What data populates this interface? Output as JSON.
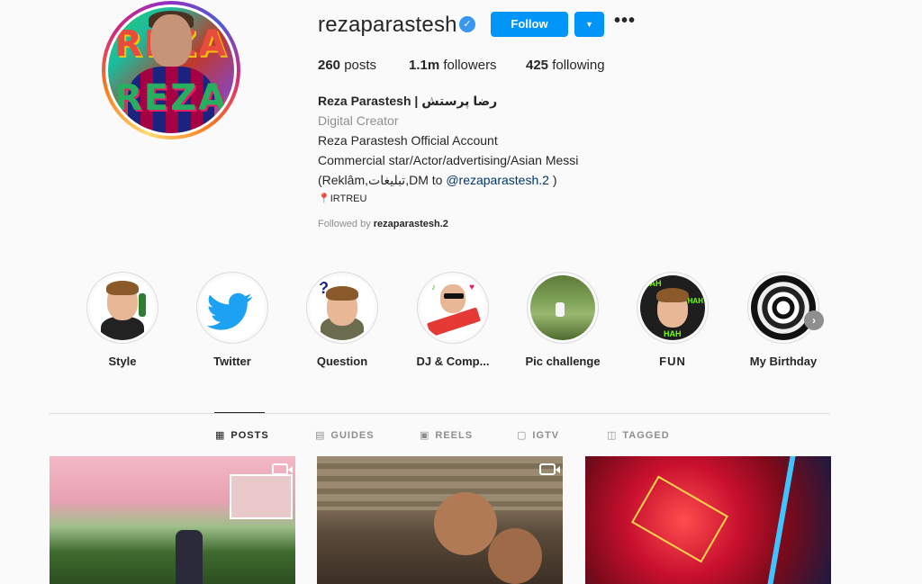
{
  "profile": {
    "username": "rezaparastesh",
    "follow_label": "Follow",
    "more_label": "•••",
    "dropdown_label": "▼",
    "verified_label": "✓"
  },
  "stats": {
    "posts_count": "260",
    "posts_label": " posts",
    "followers_count": "1.1m",
    "followers_label": " followers",
    "following_count": "425",
    "following_label": " following"
  },
  "bio": {
    "name": "Reza Parastesh | رضا پرستش",
    "category": "Digital Creator",
    "line1": "Reza Parastesh Official Account",
    "line2": "Commercial star/Actor/advertising/Asian Messi",
    "line3_prefix": "(Reklâm,تبلیغات,DM to ",
    "line3_link": "@rezaparastesh.2",
    "line3_suffix": " )",
    "line4": "📍IRTREU",
    "followed_by_prefix": "Followed by ",
    "followed_by_user": "rezaparastesh.2"
  },
  "avatar": {
    "word_top": "REZA",
    "word_bottom": "REZA"
  },
  "highlights": [
    {
      "label": "Style",
      "icon": "bitmoji-champagne"
    },
    {
      "label": "Twitter",
      "icon": "twitter-bird"
    },
    {
      "label": "Question",
      "icon": "bitmoji-question"
    },
    {
      "label": "DJ & Comp...",
      "icon": "bitmoji-keyboard"
    },
    {
      "label": "Pic challenge",
      "icon": "photo-field"
    },
    {
      "label": "FUN",
      "icon": "bitmoji-haha"
    },
    {
      "label": "My Birthday",
      "icon": "birthday-mandala"
    }
  ],
  "tabs": [
    {
      "label": "POSTS",
      "icon": "grid-icon",
      "active": true
    },
    {
      "label": "GUIDES",
      "icon": "guide-icon",
      "active": false
    },
    {
      "label": "REELS",
      "icon": "reels-icon",
      "active": false
    },
    {
      "label": "IGTV",
      "icon": "igtv-icon",
      "active": false
    },
    {
      "label": "TAGGED",
      "icon": "tagged-icon",
      "active": false
    }
  ],
  "colors": {
    "accent": "#0095f6",
    "verified": "#3897f0",
    "text": "#262626",
    "muted": "#8e8e8e",
    "link": "#00376b"
  }
}
